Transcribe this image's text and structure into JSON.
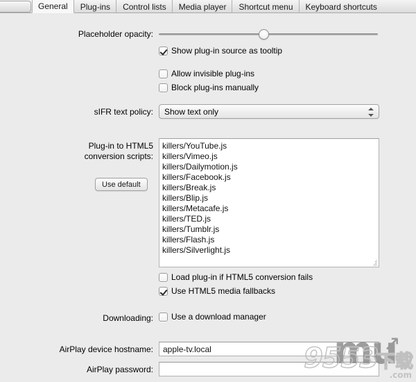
{
  "window": {
    "background_color": "#ebebeb"
  },
  "tabbar": {
    "tabs": [
      {
        "label": "General",
        "active": true
      },
      {
        "label": "Plug-ins",
        "active": false
      },
      {
        "label": "Control lists",
        "active": false
      },
      {
        "label": "Media player",
        "active": false
      },
      {
        "label": "Shortcut menu",
        "active": false
      },
      {
        "label": "Keyboard shortcuts",
        "active": false
      }
    ]
  },
  "general": {
    "placeholder_opacity": {
      "label": "Placeholder opacity:",
      "value_percent": 48,
      "min": 0,
      "max": 100
    },
    "show_source_tooltip": {
      "label": "Show plug-in source as tooltip",
      "checked": true
    },
    "allow_invisible": {
      "label": "Allow invisible plug-ins",
      "checked": false
    },
    "block_manually": {
      "label": "Block plug-ins manually",
      "checked": false
    },
    "sifr_policy": {
      "label": "sIFR text policy:",
      "selected": "Show text only",
      "options": [
        "Show text only"
      ]
    },
    "conversion_scripts": {
      "label_line1": "Plug-in to HTML5",
      "label_line2": "conversion scripts:",
      "use_default_button": "Use default",
      "lines": [
        "killers/YouTube.js",
        "killers/Vimeo.js",
        "killers/Dailymotion.js",
        "killers/Facebook.js",
        "killers/Break.js",
        "killers/Blip.js",
        "killers/Metacafe.js",
        "killers/TED.js",
        "killers/Tumblr.js",
        "killers/Flash.js",
        "killers/Silverlight.js"
      ]
    },
    "load_plugin_if_fails": {
      "label": "Load plug-in if HTML5 conversion fails",
      "checked": false
    },
    "use_media_fallbacks": {
      "label": "Use HTML5 media fallbacks",
      "checked": true
    },
    "downloading": {
      "label": "Downloading:",
      "checkbox_label": "Use a download manager",
      "checked": false
    },
    "airplay_hostname": {
      "label": "AirPlay device hostname:",
      "value": "apple-tv.local",
      "placeholder": ""
    },
    "airplay_password": {
      "label": "AirPlay password:",
      "value": "",
      "placeholder": ""
    }
  },
  "watermark": {
    "logo": "mu",
    "arrow": "↗",
    "number": "9553",
    "chinese": "下载",
    "domain": ".com"
  }
}
